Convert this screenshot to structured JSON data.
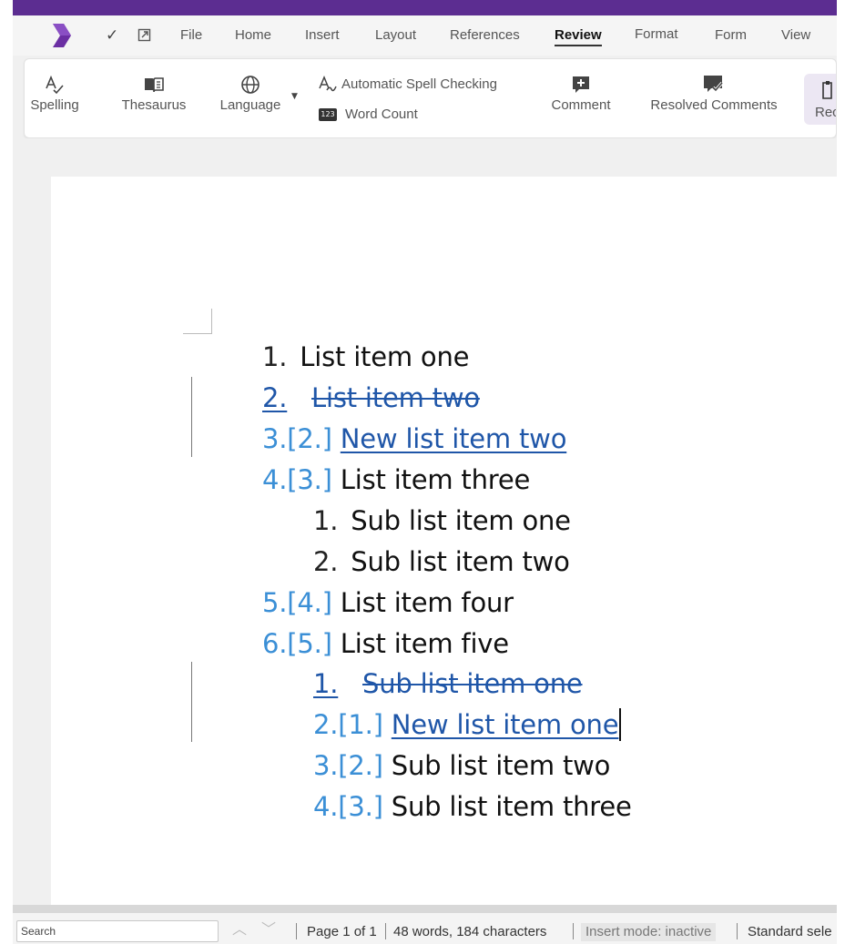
{
  "menubar": {
    "items": [
      "File",
      "Home",
      "Insert",
      "Layout",
      "References",
      "Review",
      "Format",
      "Form",
      "View"
    ],
    "active": "Review"
  },
  "ribbon": {
    "spelling": "Spelling",
    "thesaurus": "Thesaurus",
    "language": "Language",
    "auto_spell": "Automatic Spell Checking",
    "word_count": "Word Count",
    "word_count_badge": "123",
    "comment": "Comment",
    "resolved_comments": "Resolved Comments",
    "record_partial": "Rec"
  },
  "document": {
    "lines": [
      {
        "num": "1.",
        "text": "List item one"
      },
      {
        "num": "2.",
        "text": "List item two"
      },
      {
        "num_new": "3.",
        "num_old": "[2.]",
        "text": "New list item two"
      },
      {
        "num_new": "4.",
        "num_old": "[3.]",
        "text": "List item three"
      },
      {
        "num": "1.",
        "text": "Sub list item one"
      },
      {
        "num": "2.",
        "text": "Sub list item two"
      },
      {
        "num_new": "5.",
        "num_old": "[4.]",
        "text": "List item four"
      },
      {
        "num_new": "6.",
        "num_old": "[5.]",
        "text": "List item five"
      },
      {
        "num": "1.",
        "text": "Sub list item one"
      },
      {
        "num_new": "2.",
        "num_old": "[1.]",
        "text": "New list item one"
      },
      {
        "num_new": "3.",
        "num_old": "[2.]",
        "text": "Sub list item two"
      },
      {
        "num_new": "4.",
        "num_old": "[3.]",
        "text": "Sub list item three"
      }
    ]
  },
  "statusbar": {
    "search_placeholder": "Search",
    "page": "Page 1 of 1",
    "counts": "48 words, 184 characters",
    "insert_mode": "Insert mode: inactive",
    "selection_partial": "Standard sele"
  },
  "colors": {
    "brand": "#5c2d91",
    "tracked_change": "#1f56a8",
    "old_number": "#3b8fd6"
  }
}
